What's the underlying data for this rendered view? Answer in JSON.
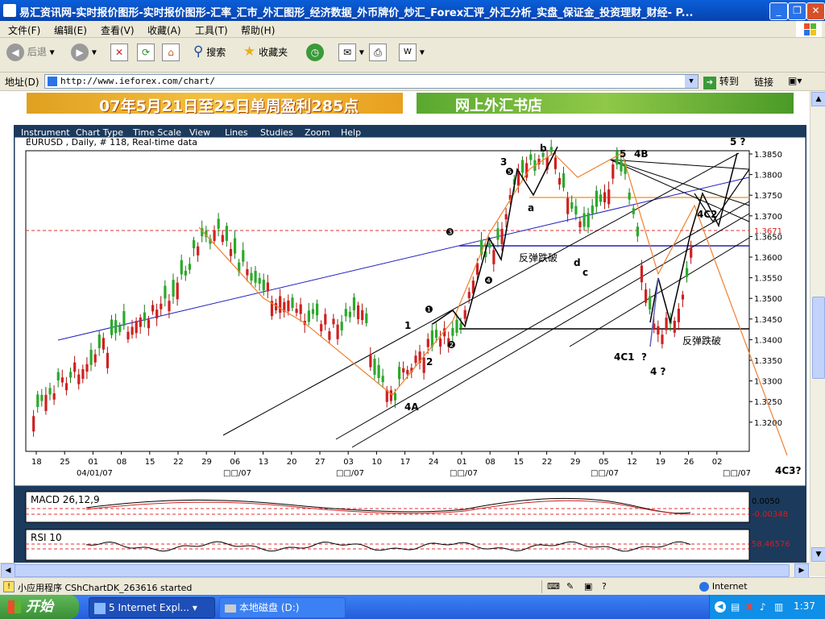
{
  "window": {
    "title": "易汇资讯网-实时报价图形-实时报价图形-汇率_汇市_外汇图形_经济数据_外币牌价_炒汇_Forex汇评_外汇分析_实盘_保证金_投资理财_财经- P..."
  },
  "menu": [
    "文件(F)",
    "编辑(E)",
    "查看(V)",
    "收藏(A)",
    "工具(T)",
    "帮助(H)"
  ],
  "toolbar": {
    "back": "后退",
    "search": "搜索",
    "favorites": "收藏夹"
  },
  "address": {
    "label": "地址(D)",
    "url": "http://www.ieforex.com/chart/",
    "go": "转到",
    "links": "链接"
  },
  "banners": {
    "left": "07年5月21日至25日单周盈利285点",
    "right": "网上外汇书店"
  },
  "chart_menu": [
    "Instrument",
    "Chart Type",
    "Time Scale",
    "View",
    "Lines",
    "Studies",
    "Zoom",
    "Help"
  ],
  "chart": {
    "info": "EURUSD , Daily, # 118, Real-time data",
    "price_labels": [
      "1.3850",
      "1.3800",
      "1.3750",
      "1.3700",
      "1.3650",
      "1.3600",
      "1.3550",
      "1.3500",
      "1.3450",
      "1.3400",
      "1.3350",
      "1.3300",
      "1.3250",
      "1.3200"
    ],
    "current_price": "1.3671",
    "date_ticks": [
      "18",
      "25",
      "01",
      "08",
      "15",
      "22",
      "29",
      "06",
      "13",
      "20",
      "27",
      "03",
      "10",
      "17",
      "24",
      "01",
      "08",
      "15",
      "22",
      "29",
      "05",
      "12",
      "19",
      "26",
      "02"
    ],
    "month_labels": [
      "04/01/07",
      "□□/07",
      "□□/07",
      "□□/07",
      "□□/07",
      "□□/07"
    ],
    "annotations": {
      "a": "a",
      "b": "b",
      "c": "c",
      "d": "d",
      "w1": "1",
      "w2": "2",
      "w3": "3",
      "w4": "4",
      "w5": "5",
      "w4A": "4A",
      "w4B": "4B",
      "w4C1": "4C1",
      "w4C2": "4C2",
      "w4C3": "4C3?",
      "q4": "4 ?",
      "q5": "5 ?",
      "qmark": "?",
      "rebound1": "反弹跌破",
      "rebound2": "反弹跌破",
      "c1": "❶",
      "c2": "❷",
      "c3": "❸",
      "c4": "❹",
      "c5": "❺"
    }
  },
  "macd": {
    "label": "MACD 26,12,9",
    "top": "0.0050",
    "value": "-0.00348"
  },
  "rsi": {
    "label": "RSI 10",
    "value": "58.46576"
  },
  "status": {
    "text": "小应用程序 CShChartDK_263616 started",
    "zone": "Internet"
  },
  "taskbar": {
    "start": "开始",
    "task1": "5 Internet Expl...",
    "task2": "本地磁盘 (D:)",
    "clock": "1:37"
  },
  "chart_data": {
    "type": "candlestick",
    "title": "EURUSD , Daily, # 118, Real-time data",
    "ylim": [
      1.315,
      1.39
    ],
    "reference_lines": [
      1.3671,
      1.363,
      1.3435
    ]
  }
}
